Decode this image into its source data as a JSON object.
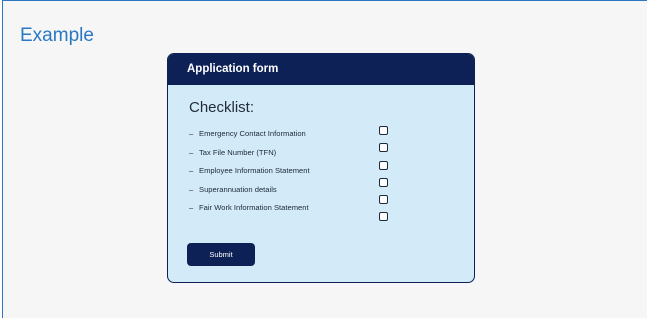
{
  "example": {
    "title": "Example"
  },
  "form": {
    "header": "Application form",
    "checklist_title": "Checklist:",
    "items": [
      {
        "label": "Emergency Contact Information",
        "checked": false
      },
      {
        "label": "Tax File Number (TFN)",
        "checked": false
      },
      {
        "label": "Employee Information Statement",
        "checked": false
      },
      {
        "label": "Superannuation details",
        "checked": false
      },
      {
        "label": "Fair Work Information Statement",
        "checked": false
      },
      {
        "label": "",
        "checked": false
      }
    ],
    "item_bullet": "–",
    "submit_label": "Submit"
  },
  "colors": {
    "accent": "#2a78c4",
    "navy": "#0d2156",
    "card_bg": "#d3eaf9",
    "page_bg": "#f6f6f6"
  }
}
